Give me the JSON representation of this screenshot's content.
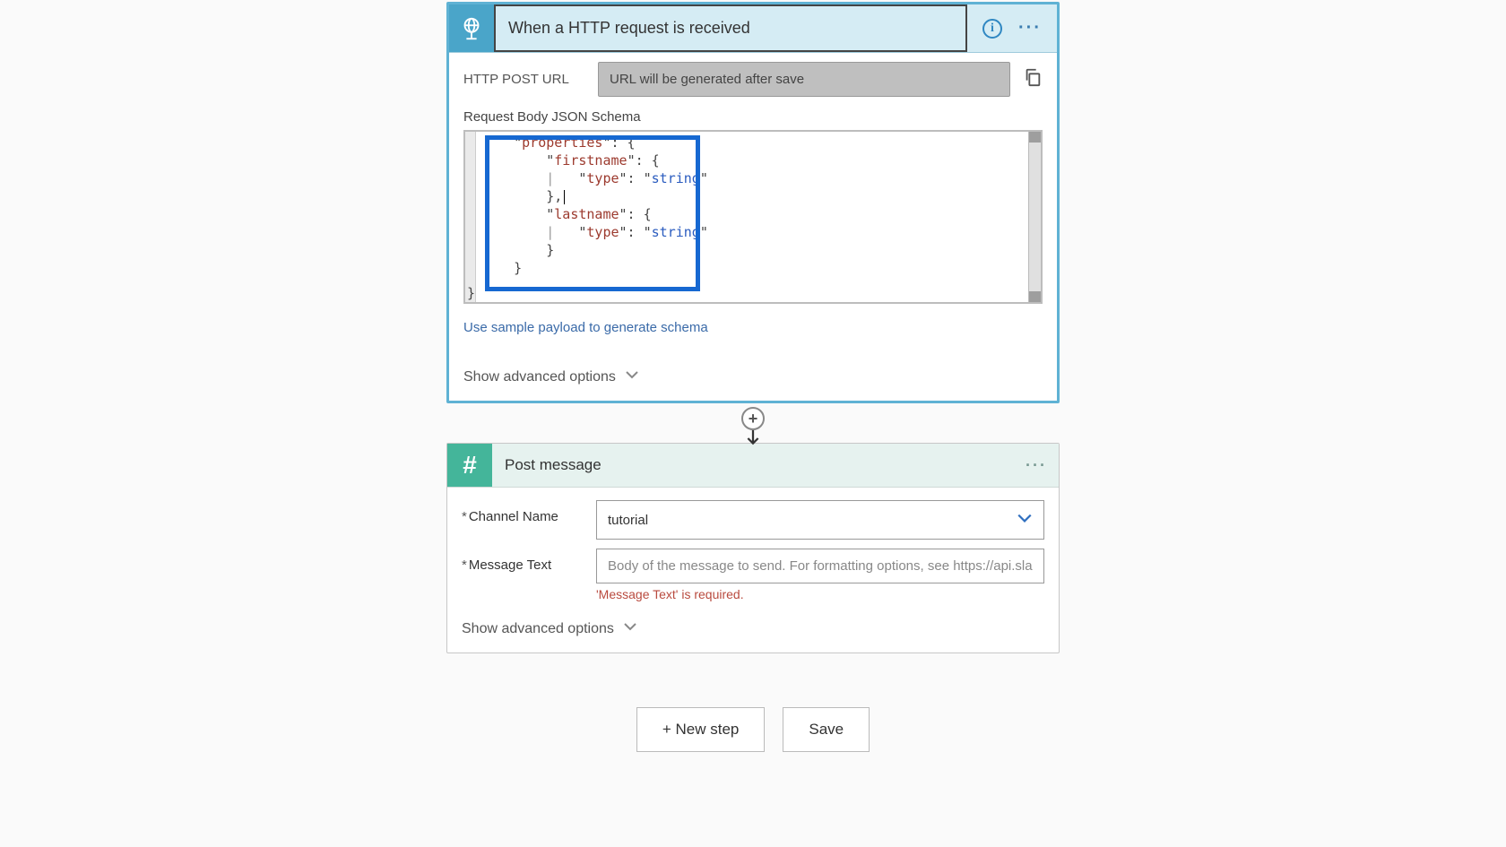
{
  "trigger": {
    "title": "When a HTTP request is received",
    "url_label": "HTTP POST URL",
    "url_value": "URL will be generated after save",
    "schema_label": "Request Body JSON Schema",
    "schema_keys": {
      "properties": "properties",
      "firstname": "firstname",
      "lastname": "lastname",
      "type": "type",
      "string": "string"
    },
    "sample_link": "Use sample payload to generate schema",
    "advanced": "Show advanced options"
  },
  "slack": {
    "title": "Post message",
    "channel_label": "Channel Name",
    "channel_value": "tutorial",
    "message_label": "Message Text",
    "message_placeholder": "Body of the message to send. For formatting options, see https://api.slack.com/",
    "message_error": "'Message Text' is required.",
    "advanced": "Show advanced options"
  },
  "buttons": {
    "new_step": "+ New step",
    "save": "Save"
  }
}
